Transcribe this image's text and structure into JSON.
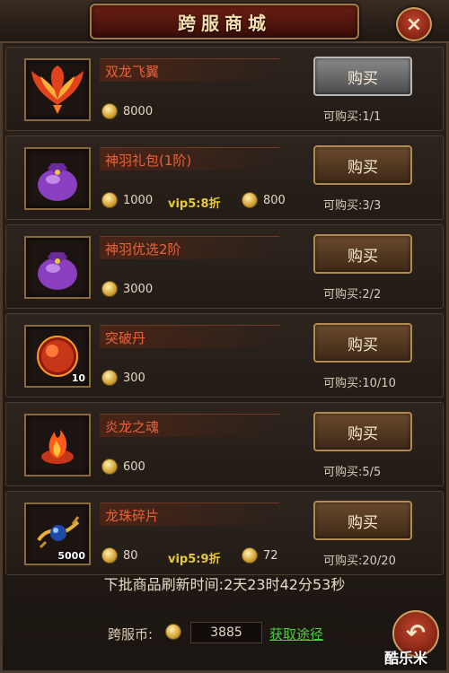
{
  "header": {
    "title": "跨服商城",
    "close_icon": "×"
  },
  "items": [
    {
      "name": "双龙飞翼",
      "price": "8000",
      "buy_label": "购买",
      "limit": "可购买:1/1",
      "qty": "",
      "icon": "phoenix-wings-icon",
      "disabled": true
    },
    {
      "name": "神羽礼包(1阶)",
      "price": "1000",
      "vip_text": "vip5:8折",
      "vip_price": "800",
      "buy_label": "购买",
      "limit": "可购买:3/3",
      "qty": "",
      "icon": "purple-bag-icon"
    },
    {
      "name": "神羽优选2阶",
      "price": "3000",
      "buy_label": "购买",
      "limit": "可购买:2/2",
      "qty": "",
      "icon": "purple-bag-icon"
    },
    {
      "name": "突破丹",
      "price": "300",
      "buy_label": "购买",
      "limit": "可购买:10/10",
      "qty": "10",
      "icon": "red-orb-icon"
    },
    {
      "name": "炎龙之魂",
      "price": "600",
      "buy_label": "购买",
      "limit": "可购买:5/5",
      "qty": "",
      "icon": "flame-soul-icon"
    },
    {
      "name": "龙珠碎片",
      "price": "80",
      "vip_text": "vip5:9折",
      "vip_price": "72",
      "buy_label": "购买",
      "limit": "可购买:20/20",
      "qty": "5000",
      "icon": "dragon-pearl-icon"
    }
  ],
  "footer": {
    "refresh_text": "下批商品刷新时间:2天23时42分53秒",
    "currency_label": "跨服币:",
    "currency_value": "3885",
    "get_link": "获取途径",
    "back_icon": "↶"
  },
  "watermark": "酷乐米",
  "colors": {
    "item_name": "#e9623a",
    "vip": "#e6c93a",
    "link": "#4ad23a"
  }
}
